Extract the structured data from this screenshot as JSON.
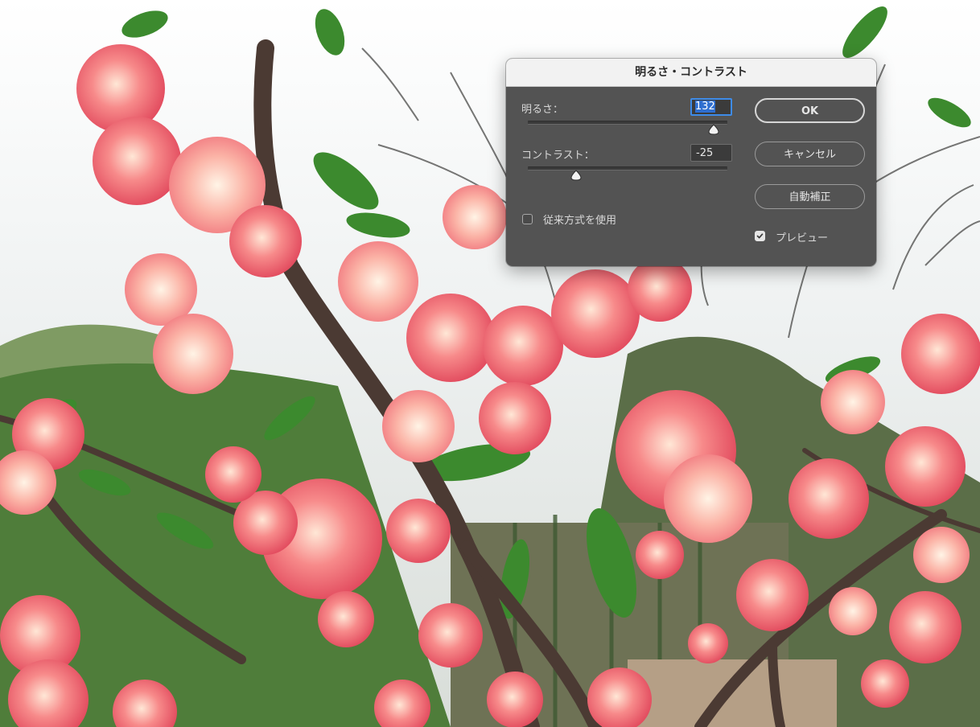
{
  "dialog": {
    "title": "明るさ・コントラスト",
    "brightness": {
      "label": "明るさ：",
      "value": "132",
      "level": 0.93
    },
    "contrast": {
      "label": "コントラスト：",
      "value": "-25",
      "level": 0.24
    },
    "legacy": {
      "label": "従来方式を使用",
      "checked": false
    },
    "preview": {
      "label": "プレビュー",
      "checked": true
    },
    "buttons": {
      "ok": "OK",
      "cancel": "キャンセル",
      "auto": "自動補正"
    }
  },
  "colors": {
    "dialog_bg": "#535353",
    "titlebar_bg": "#f2f2f2",
    "focus_accent": "#3e8be8",
    "selection": "#2f6fd0"
  }
}
